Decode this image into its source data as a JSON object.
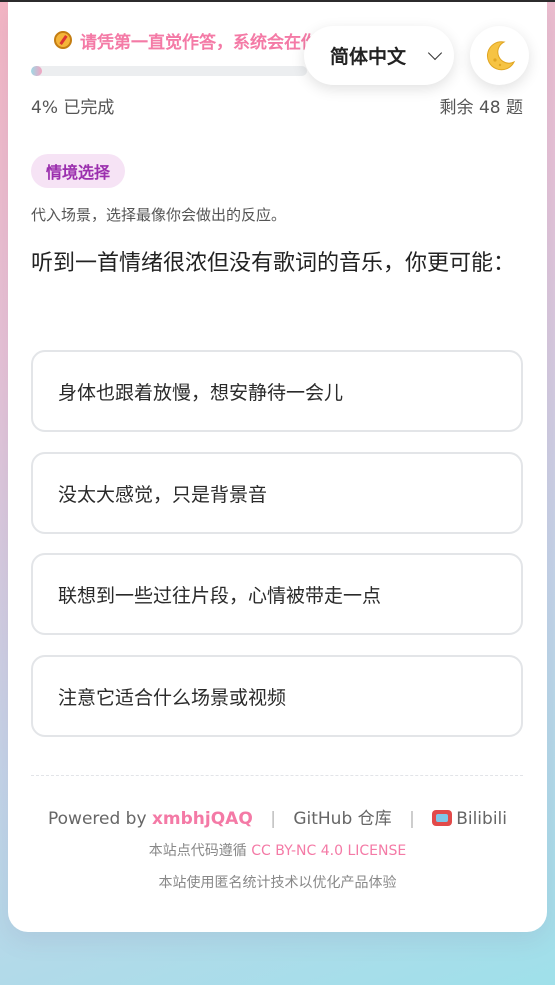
{
  "hint": {
    "text": "请凭第一直觉作答，系统会在你最有可能的波动"
  },
  "progress": {
    "percent": 4,
    "done_label": "4% 已完成",
    "remaining_label": "剩余 48 题"
  },
  "language": {
    "selected": "简体中文"
  },
  "section": {
    "badge": "情境选择",
    "subtitle": "代入场景，选择最像你会做出的反应。"
  },
  "question": "听到一首情绪很浓但没有歌词的音乐，你更可能：",
  "options": [
    {
      "label": "身体也跟着放慢，想安静待一会儿"
    },
    {
      "label": "没太大感觉，只是背景音"
    },
    {
      "label": "联想到一些过往片段，心情被带走一点"
    },
    {
      "label": "注意它适合什么场景或视频"
    }
  ],
  "footer": {
    "powered_by": "Powered by",
    "author": "xmbhjQAQ",
    "sep1": "|",
    "github": "GitHub 仓库",
    "sep2": "|",
    "bilibili": "Bilibili",
    "license_prefix": "本站点代码遵循",
    "license_link": "CC BY-NC 4.0 LICENSE",
    "stats_notice": "本站使用匿名统计技术以优化产品体验"
  },
  "colors": {
    "accent_pink": "#f47aa6",
    "badge_purple": "#9b2fae",
    "moon": "#f6c343"
  },
  "icons": {
    "hint": "compass-icon",
    "theme": "moon-icon",
    "lang": "chevron-down-icon",
    "bilibili": "tv-icon"
  }
}
